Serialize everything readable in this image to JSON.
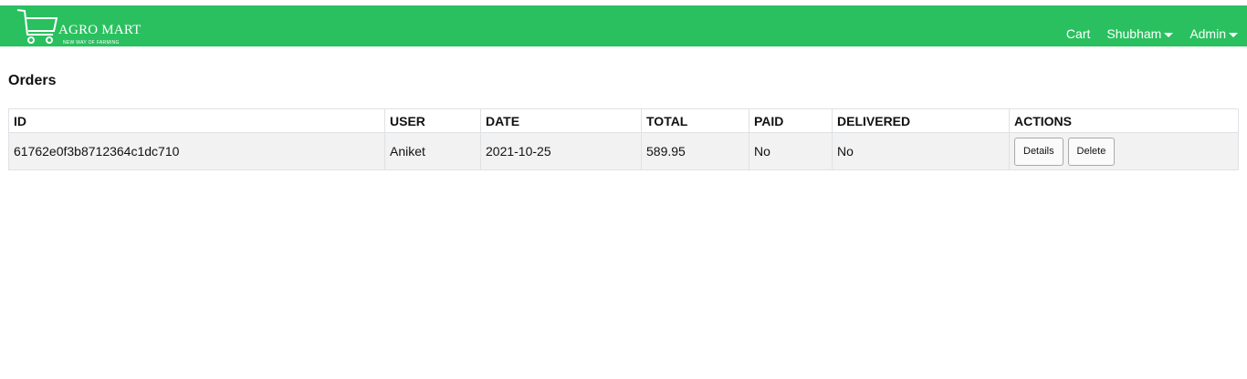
{
  "brand": {
    "title": "AGRO MART",
    "tagline": "NEW WAY OF FARMING",
    "logo_icon": "shopping-cart-icon"
  },
  "nav": {
    "cart": "Cart",
    "user": "Shubham",
    "admin": "Admin"
  },
  "page": {
    "title": "Orders"
  },
  "table": {
    "columns": [
      "ID",
      "USER",
      "DATE",
      "TOTAL",
      "PAID",
      "DELIVERED",
      "ACTIONS"
    ],
    "rows": [
      {
        "id": "61762e0f3b8712364c1dc710",
        "user": "Aniket",
        "date": "2021-10-25",
        "total": "589.95",
        "paid": "No",
        "delivered": "No",
        "details_label": "Details",
        "delete_label": "Delete"
      }
    ]
  },
  "colors": {
    "navbar": "#2ac05f",
    "row_background": "#f2f2f2"
  }
}
